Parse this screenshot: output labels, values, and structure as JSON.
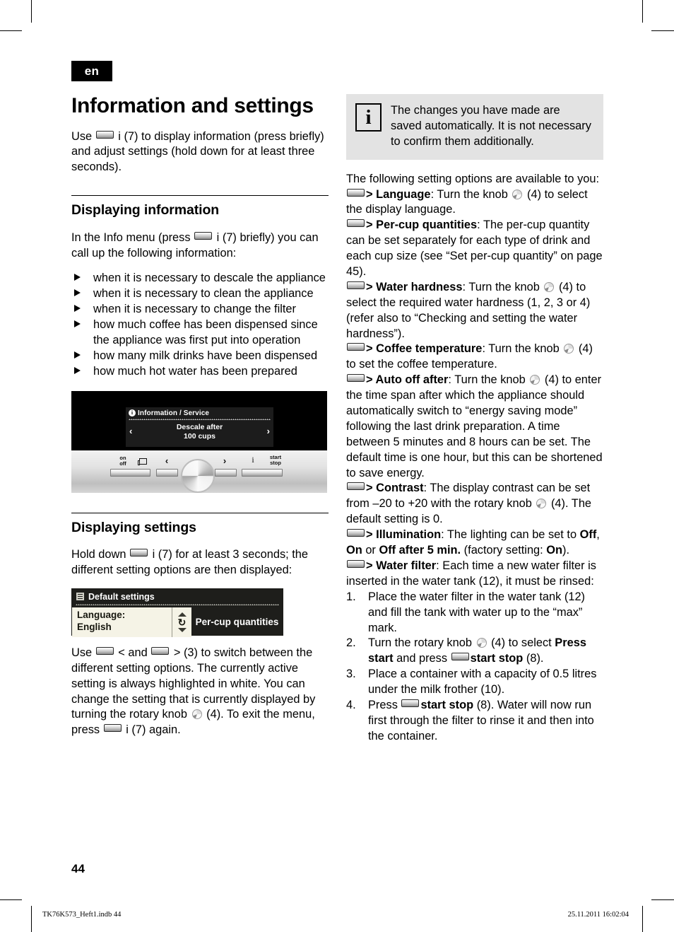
{
  "crop_marks": true,
  "language_tag": "en",
  "page_number": "44",
  "footer": {
    "file": "TK76K573_Heft1.indb   44",
    "datetime": "25.11.2011   16:02:04"
  },
  "left_column": {
    "title": "Information and settings",
    "intro_a": "Use ",
    "intro_b": " i (7) to display information (press briefly) and adjust settings (hold down for at least three seconds).",
    "section1": {
      "heading": "Displaying information",
      "intro_a": "In the Info menu (press ",
      "intro_b": " i (7) briefly) you can call up the following information:",
      "bullets": [
        "when it is necessary to descale the appliance",
        "when it is necessary to clean the appliance",
        "when it is necessary to change the filter",
        "how much coffee has been dispensed since the appliance was first put into operation",
        "how many milk drinks have been dispensed",
        "how much hot water has been prepared"
      ]
    },
    "control_panel_image": {
      "lcd_title": "Information / Service",
      "lcd_line1": "Descale after",
      "lcd_line2": "100 cups",
      "arrow_left": "‹",
      "arrow_right": "›",
      "keys": [
        {
          "label_line1": "on",
          "label_line2": "off"
        },
        {
          "label_line1": "‹",
          "label_line2": ""
        },
        {
          "label_line1": "›",
          "label_line2": ""
        },
        {
          "label_line1": "i",
          "label_line2": ""
        },
        {
          "label_line1": "start",
          "label_line2": "stop"
        }
      ]
    },
    "section2": {
      "heading": "Displaying settings",
      "intro_a": "Hold down ",
      "intro_b": " i (7) for at least 3 seconds; the different setting options are then displayed:",
      "display_image": {
        "header": "Default settings",
        "highlight_line1": "Language:",
        "highlight_line2": "English",
        "right_label": "Per-cup quantities"
      },
      "after_a": "Use ",
      "after_b": " < and ",
      "after_c": " > (3) to switch between the different setting options. The currently active setting is always highlighted in white. You can change the setting that is currently displayed by turning the rotary knob ",
      "after_d": " (4). To exit the menu, press ",
      "after_e": " i (7) again."
    }
  },
  "right_column": {
    "infobox": {
      "icon": "i",
      "text": "The changes you have made are saved automatically. It is not necessary to confirm them additionally."
    },
    "lead": "The following setting options are available to you:",
    "settings": [
      {
        "name": "Language",
        "before": "> ",
        "after_a": ": Turn the knob ",
        "after_b": " (4) to select the display language."
      },
      {
        "name": "Per-cup quantities",
        "before": "> ",
        "after_a": ": The per-cup quantity can be set separately for each type of drink and each cup size (see “Set per-cup quantity” on page 45).",
        "after_b": ""
      },
      {
        "name": "Water hardness",
        "before": "> ",
        "after_a": ": Turn the knob ",
        "after_b": " (4) to select the required water hardness (1, 2, 3 or 4) (refer also to “Checking and setting the water hardness”)."
      },
      {
        "name": "Coffee temperature",
        "before": "> ",
        "after_a": ": Turn the knob ",
        "after_b": " (4) to set the coffee temperature."
      },
      {
        "name": "Auto off after",
        "before": "> ",
        "after_a": ": Turn the knob ",
        "after_b": " (4) to enter the time span after which the appliance should automatically switch to “energy saving mode” following the last drink preparation. A time between 5 minutes and 8 hours can be set. The default time is one hour, but this can be shortened to save energy."
      },
      {
        "name": "Contrast",
        "before": "> ",
        "after_a": ": The display contrast can be set from –20 to +20 with the rotary knob ",
        "after_b": " (4). The default setting is 0."
      }
    ],
    "illumination": {
      "name": "Illumination",
      "before": "> ",
      "text_a": ": The lighting can be set to ",
      "opt1": "Off",
      "sep1": ", ",
      "opt2": "On",
      "sep2": " or ",
      "opt3": "Off after 5 min.",
      "text_b": " (factory setting: ",
      "opt4": "On",
      "text_c": ")."
    },
    "water_filter": {
      "name": "Water filter",
      "before": "> ",
      "text": ": Each time a new water filter is inserted in the water tank (12), it must be rinsed:",
      "steps": [
        {
          "num": "1.",
          "text_a": "Place the water filter in the water tank (12) and fill the tank with water up to the “max” mark."
        },
        {
          "num": "2.",
          "text_a": "Turn the rotary knob ",
          "text_b": " (4) to select ",
          "bold1": "Press start",
          "text_c": " and press ",
          "bold2": "start stop",
          "text_d": " (8)."
        },
        {
          "num": "3.",
          "text_a": "Place a container with a capacity of 0.5 litres under the milk frother (10)."
        },
        {
          "num": "4.",
          "text_a": "Press ",
          "bold1": "start stop",
          "text_b": " (8). Water will now run first through the filter to rinse it and then into the container."
        }
      ]
    }
  }
}
